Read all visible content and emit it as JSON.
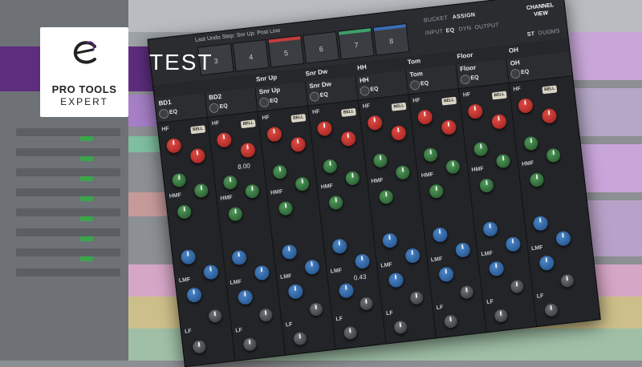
{
  "branding": {
    "logo_line1": "PRO TOOLS",
    "logo_line2": "EXPERT",
    "logo_icon": "e-swoosh-logo",
    "banner_text": "TEST",
    "banner_color": "#5e2d7e"
  },
  "plugin": {
    "top_note": "Last Undo Step: Snr Up: Post Line",
    "slots": [
      {
        "num": "3",
        "color": "#3a3d42"
      },
      {
        "num": "4",
        "color": "#3a3d42"
      },
      {
        "num": "5",
        "color": "#c23c3c"
      },
      {
        "num": "6",
        "color": "#3a3d42"
      },
      {
        "num": "7",
        "color": "#3ea06a"
      },
      {
        "num": "8",
        "color": "#3c6db5"
      }
    ],
    "controls": {
      "bucket": "BUCKET",
      "assign": "ASSIGN",
      "input": "INPUT",
      "eq": "EQ",
      "dyn": "DYN",
      "output": "OUTPUT",
      "channel_view": "CHANNEL VIEW",
      "st": "ST",
      "dug": "DUG",
      "ms": "MS"
    },
    "tabs": [
      {
        "label": "Snr Up"
      },
      {
        "label": "Snr Dw"
      },
      {
        "label": "HH"
      },
      {
        "label": "Tom"
      },
      {
        "label": "Floor"
      },
      {
        "label": "OH"
      }
    ],
    "strips": [
      {
        "name": "BD1",
        "eq": "EQ",
        "hf": "HF",
        "hmf": "HMF",
        "lmf": "LMF",
        "lf": "LF",
        "bell": "BELL",
        "readout": ""
      },
      {
        "name": "BD2",
        "eq": "EQ",
        "hf": "HF",
        "hmf": "HMF",
        "lmf": "LMF",
        "lf": "LF",
        "bell": "BELL",
        "readout": "8.00"
      },
      {
        "name": "Snr Up",
        "eq": "EQ",
        "hf": "HF",
        "hmf": "HMF",
        "lmf": "LMF",
        "lf": "LF",
        "bell": "BELL",
        "readout": ""
      },
      {
        "name": "Snr Dw",
        "eq": "EQ",
        "hf": "HF",
        "hmf": "HMF",
        "lmf": "LMF",
        "lf": "LF",
        "bell": "BELL",
        "readout": "0.43"
      },
      {
        "name": "HH",
        "eq": "EQ",
        "hf": "HF",
        "hmf": "HMF",
        "lmf": "LMF",
        "lf": "LF",
        "bell": "BELL",
        "readout": ""
      },
      {
        "name": "Tom",
        "eq": "EQ",
        "hf": "HF",
        "hmf": "HMF",
        "lmf": "LMF",
        "lf": "LF",
        "bell": "BELL",
        "readout": ""
      },
      {
        "name": "Floor",
        "eq": "EQ",
        "hf": "HF",
        "hmf": "HMF",
        "lmf": "LMF",
        "lf": "LF",
        "bell": "BELL",
        "readout": ""
      },
      {
        "name": "OH",
        "eq": "EQ",
        "hf": "HF",
        "hmf": "HMF",
        "lmf": "LMF",
        "lf": "LF",
        "bell": "BELL",
        "readout": ""
      }
    ]
  }
}
